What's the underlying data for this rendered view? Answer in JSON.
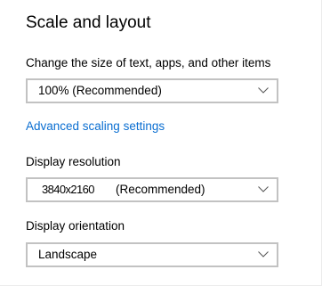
{
  "scale_and_layout": {
    "title": "Scale and layout",
    "scale_label": "Change the size of text, apps, and other items",
    "scale_value": "100% (Recommended)",
    "advanced_link": "Advanced scaling settings",
    "resolution_label": "Display resolution",
    "resolution_value": "3840x2160",
    "resolution_note": "(Recommended)",
    "orientation_label": "Display orientation",
    "orientation_value": "Landscape"
  },
  "icons": {
    "dropdown_chevron": "chevron-down-icon"
  },
  "colors": {
    "link": "#0a6ed1",
    "border": "#c2c2c2",
    "chevron": "#555555"
  }
}
